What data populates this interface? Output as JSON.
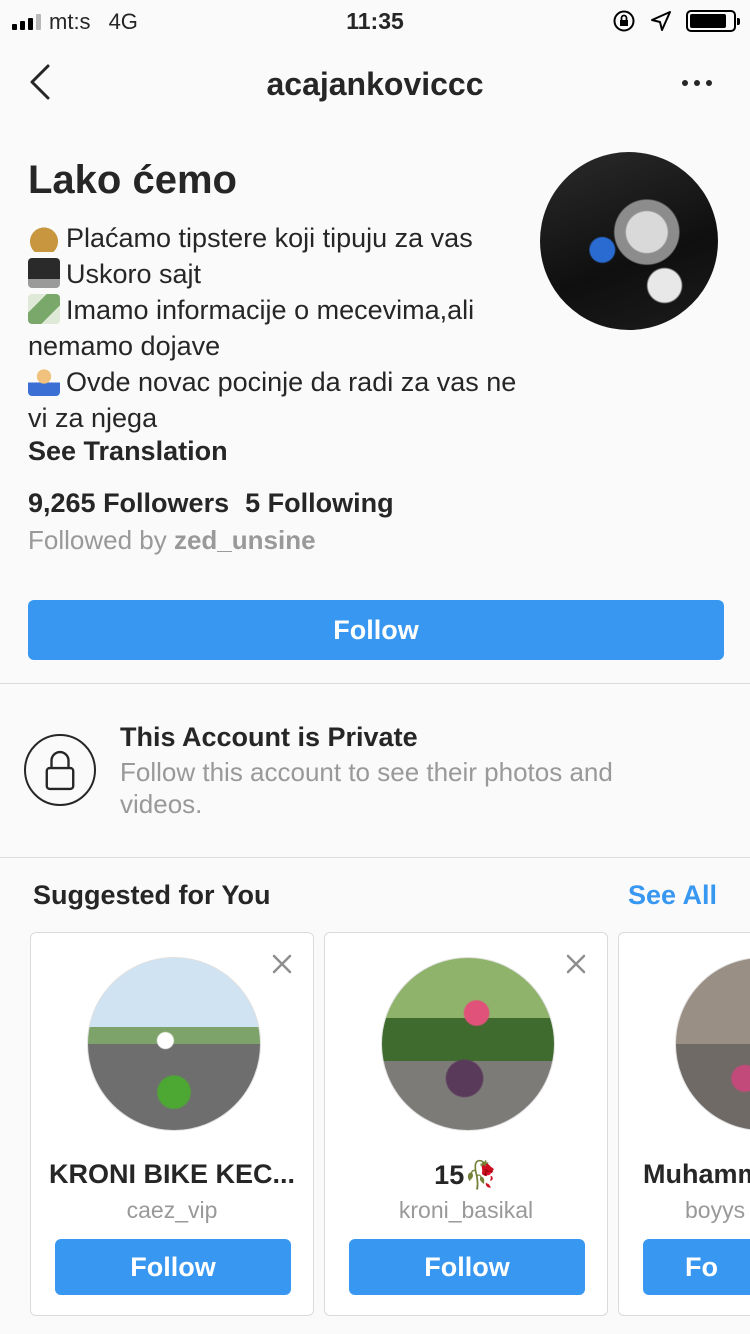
{
  "status_bar": {
    "carrier": "mt:s",
    "network": "4G",
    "time": "11:35",
    "battery_level": 0.85
  },
  "header": {
    "username": "acajankoviccc"
  },
  "profile": {
    "display_name": "Lako ćemo",
    "bio_lines": [
      {
        "icon": "money-bag-icon",
        "text": "Plaćamo tipstere koji tipuju za vas"
      },
      {
        "icon": "laptop-icon",
        "text": "Uskoro sajt"
      },
      {
        "icon": "money-wings-icon",
        "text": "Imamo informacije o mecevima,ali nemamo dojave"
      },
      {
        "icon": "shrug-person-icon",
        "text": "Ovde novac pocinje da radi za vas ne vi za njega"
      }
    ],
    "see_translation": "See Translation",
    "followers": "9,265 Followers",
    "following": "5 Following",
    "followed_by_prefix": "Followed by",
    "followed_by_user": "zed_unsine",
    "follow_label": "Follow"
  },
  "private_notice": {
    "title": "This Account is Private",
    "subtitle": "Follow this account to see their photos and videos."
  },
  "suggested": {
    "title": "Suggested for You",
    "see_all": "See All",
    "cards": [
      {
        "name": "KRONI BIKE KEC...",
        "username": "caez_vip",
        "button": "Follow"
      },
      {
        "name": "15🥀",
        "username": "kroni_basikal",
        "button": "Follow"
      },
      {
        "name": "Muhamm",
        "username": "boyys",
        "button": "Fo"
      }
    ]
  },
  "colors": {
    "accent": "#3897f0",
    "text": "#262626",
    "secondary_text": "#999999",
    "background": "#fafafa"
  }
}
